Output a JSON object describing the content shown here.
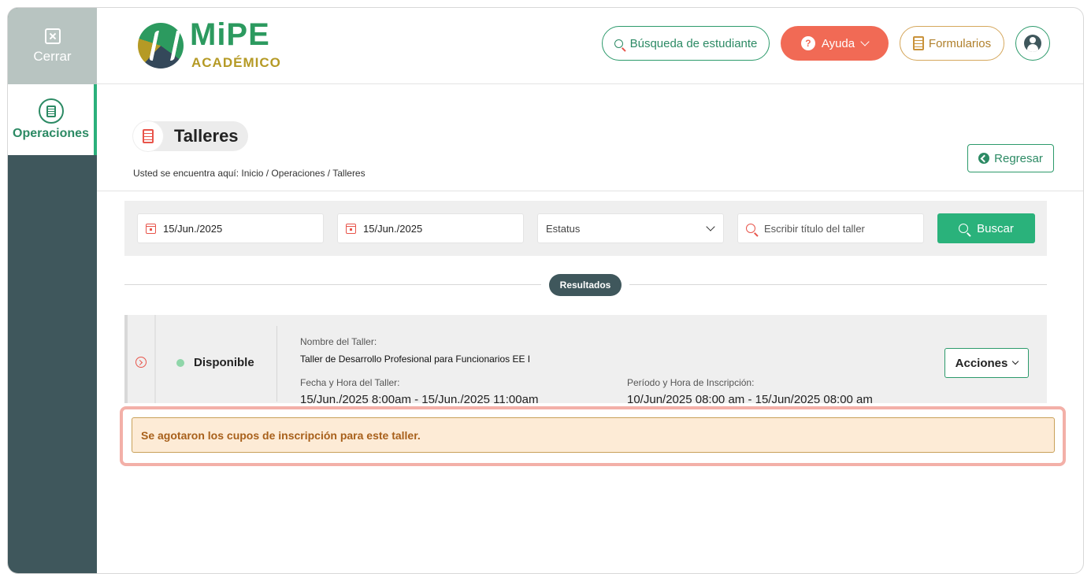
{
  "sidebar": {
    "close_label": "Cerrar",
    "operations_label": "Operaciones"
  },
  "header": {
    "logo_main": "MiPE",
    "logo_sub": "ACADÉMICO",
    "search_student": "Búsqueda de estudiante",
    "help": "Ayuda",
    "forms": "Formularios"
  },
  "page": {
    "title": "Talleres",
    "breadcrumb": "Usted se encuentra aquí: Inicio / Operaciones / Talleres",
    "back": "Regresar"
  },
  "filters": {
    "date_from": "15/Jun./2025",
    "date_to": "15/Jun./2025",
    "status_placeholder": "Estatus",
    "title_placeholder": "Escribir título del taller",
    "search_button": "Buscar"
  },
  "results": {
    "label": "Resultados",
    "items": [
      {
        "status": "Disponible",
        "name_label": "Nombre del Taller:",
        "name": "Taller de Desarrollo Profesional para Funcionarios EE I",
        "datetime_label": "Fecha y Hora del Taller:",
        "datetime": "15/Jun./2025 8:00am - 15/Jun./2025 11:00am",
        "enroll_label": "Período y Hora de Inscripción:",
        "enroll": "10/Jun/2025 08:00 am - 15/Jun/2025 08:00 am",
        "actions": "Acciones"
      }
    ],
    "alert": "Se agotaron los cupos de inscripción para este taller."
  },
  "colors": {
    "sidebar": "#3f575c",
    "accent_green": "#2ab27b",
    "help_red": "#f16a55",
    "alert_bg": "#fdebd6",
    "alert_text": "#a8601b"
  }
}
